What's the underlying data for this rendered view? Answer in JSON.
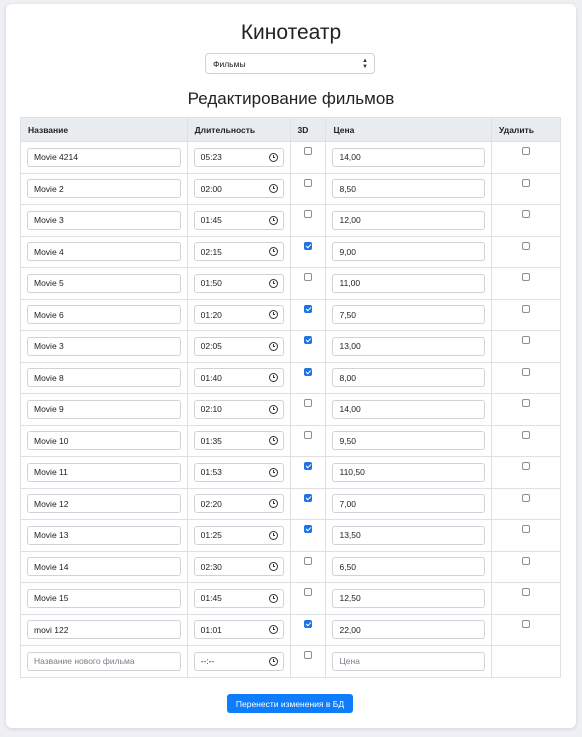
{
  "header": {
    "title": "Кинотеатр"
  },
  "selector": {
    "value": "Фильмы",
    "options": [
      "Фильмы"
    ]
  },
  "section": {
    "title": "Редактирование фильмов"
  },
  "table": {
    "columns": [
      "Название",
      "Длительность",
      "3D",
      "Цена",
      "Удалить"
    ],
    "rows": [
      {
        "name": "Movie 4214",
        "duration": "05:23",
        "is3d": false,
        "price": "14,00",
        "delete": false
      },
      {
        "name": "Movie 2",
        "duration": "02:00",
        "is3d": false,
        "price": "8,50",
        "delete": false
      },
      {
        "name": "Movie 3",
        "duration": "01:45",
        "is3d": false,
        "price": "12,00",
        "delete": false
      },
      {
        "name": "Movie 4",
        "duration": "02:15",
        "is3d": true,
        "price": "9,00",
        "delete": false
      },
      {
        "name": "Movie 5",
        "duration": "01:50",
        "is3d": false,
        "price": "11,00",
        "delete": false
      },
      {
        "name": "Movie 6",
        "duration": "01:20",
        "is3d": true,
        "price": "7,50",
        "delete": false
      },
      {
        "name": "Movie 3",
        "duration": "02:05",
        "is3d": true,
        "price": "13,00",
        "delete": false
      },
      {
        "name": "Movie 8",
        "duration": "01:40",
        "is3d": true,
        "price": "8,00",
        "delete": false
      },
      {
        "name": "Movie 9",
        "duration": "02:10",
        "is3d": false,
        "price": "14,00",
        "delete": false
      },
      {
        "name": "Movie 10",
        "duration": "01:35",
        "is3d": false,
        "price": "9,50",
        "delete": false
      },
      {
        "name": "Movie 11",
        "duration": "01:53",
        "is3d": true,
        "price": "110,50",
        "delete": false
      },
      {
        "name": "Movie 12",
        "duration": "02:20",
        "is3d": true,
        "price": "7,00",
        "delete": false
      },
      {
        "name": "Movie 13",
        "duration": "01:25",
        "is3d": true,
        "price": "13,50",
        "delete": false
      },
      {
        "name": "Movie 14",
        "duration": "02:30",
        "is3d": false,
        "price": "6,50",
        "delete": false
      },
      {
        "name": "Movie 15",
        "duration": "01:45",
        "is3d": false,
        "price": "12,50",
        "delete": false
      },
      {
        "name": "movi 122",
        "duration": "01:01",
        "is3d": true,
        "price": "22,00",
        "delete": false
      }
    ],
    "new_row": {
      "name_placeholder": "Название нового фильма",
      "duration_placeholder": "--:--",
      "is3d": false,
      "price_placeholder": "Цена"
    }
  },
  "actions": {
    "submit_label": "Перенести изменения в БД"
  },
  "colors": {
    "accent": "#0d7dfb",
    "header_bg": "#e9ecef",
    "page_bg": "#eef0f3"
  }
}
